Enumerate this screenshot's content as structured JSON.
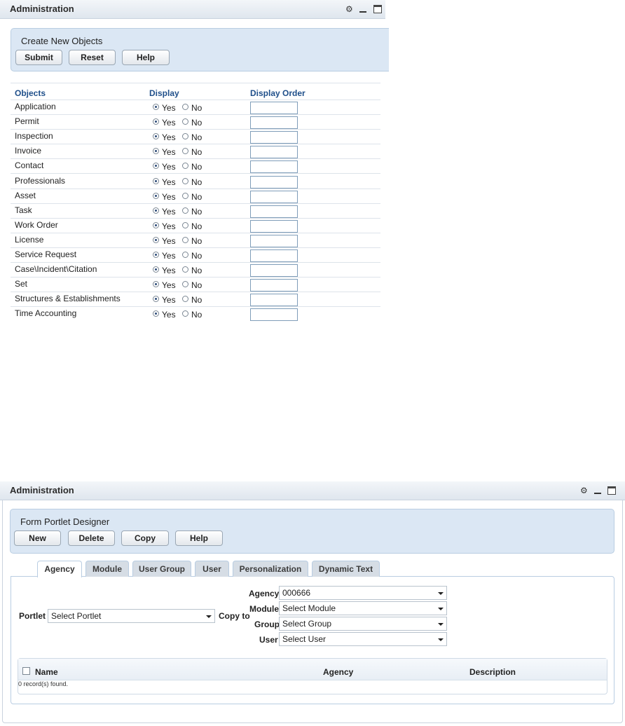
{
  "top_portlet": {
    "title": "Administration",
    "panel_title": "Create New Objects",
    "buttons": {
      "submit": "Submit",
      "reset": "Reset",
      "help": "Help"
    },
    "columns": {
      "objects": "Objects",
      "display": "Display",
      "display_order": "Display Order"
    },
    "radio_yes": "Yes",
    "radio_no": "No",
    "objects": [
      {
        "name": "Application",
        "display": "Yes",
        "order": ""
      },
      {
        "name": "Permit",
        "display": "Yes",
        "order": ""
      },
      {
        "name": "Inspection",
        "display": "Yes",
        "order": ""
      },
      {
        "name": "Invoice",
        "display": "Yes",
        "order": ""
      },
      {
        "name": "Contact",
        "display": "Yes",
        "order": ""
      },
      {
        "name": "Professionals",
        "display": "Yes",
        "order": ""
      },
      {
        "name": "Asset",
        "display": "Yes",
        "order": ""
      },
      {
        "name": "Task",
        "display": "Yes",
        "order": ""
      },
      {
        "name": "Work Order",
        "display": "Yes",
        "order": ""
      },
      {
        "name": "License",
        "display": "Yes",
        "order": ""
      },
      {
        "name": "Service Request",
        "display": "Yes",
        "order": ""
      },
      {
        "name": "Case\\Incident\\Citation",
        "display": "Yes",
        "order": ""
      },
      {
        "name": "Set",
        "display": "Yes",
        "order": ""
      },
      {
        "name": "Structures & Establishments",
        "display": "Yes",
        "order": ""
      },
      {
        "name": "Time Accounting",
        "display": "Yes",
        "order": ""
      }
    ]
  },
  "bottom_portlet": {
    "title": "Administration",
    "panel_title": "Form Portlet Designer",
    "buttons": {
      "new": "New",
      "delete": "Delete",
      "copy": "Copy",
      "help": "Help"
    },
    "tabs": [
      {
        "label": "Agency",
        "active": true
      },
      {
        "label": "Module",
        "active": false
      },
      {
        "label": "User Group",
        "active": false
      },
      {
        "label": "User",
        "active": false
      },
      {
        "label": "Personalization",
        "active": false
      },
      {
        "label": "Dynamic Text",
        "active": false
      }
    ],
    "form": {
      "portlet_label": "Portlet",
      "portlet_value": "Select Portlet",
      "copy_to_label": "Copy to",
      "agency_label": "Agency",
      "agency_value": "000666",
      "module_label": "Module",
      "module_value": "Select Module",
      "group_label": "Group",
      "group_value": "Select Group",
      "user_label": "User",
      "user_value": "Select User"
    },
    "grid": {
      "columns": {
        "name": "Name",
        "agency": "Agency",
        "description": "Description"
      },
      "records_text": "0 record(s) found."
    }
  },
  "icons": {
    "config": "config-icon",
    "minimize": "minimize-icon",
    "maximize": "maximize-icon"
  },
  "colors": {
    "header_text": "#1f4f8a",
    "panel_bg": "#dbe7f4",
    "panel_border": "#b9cde2"
  }
}
